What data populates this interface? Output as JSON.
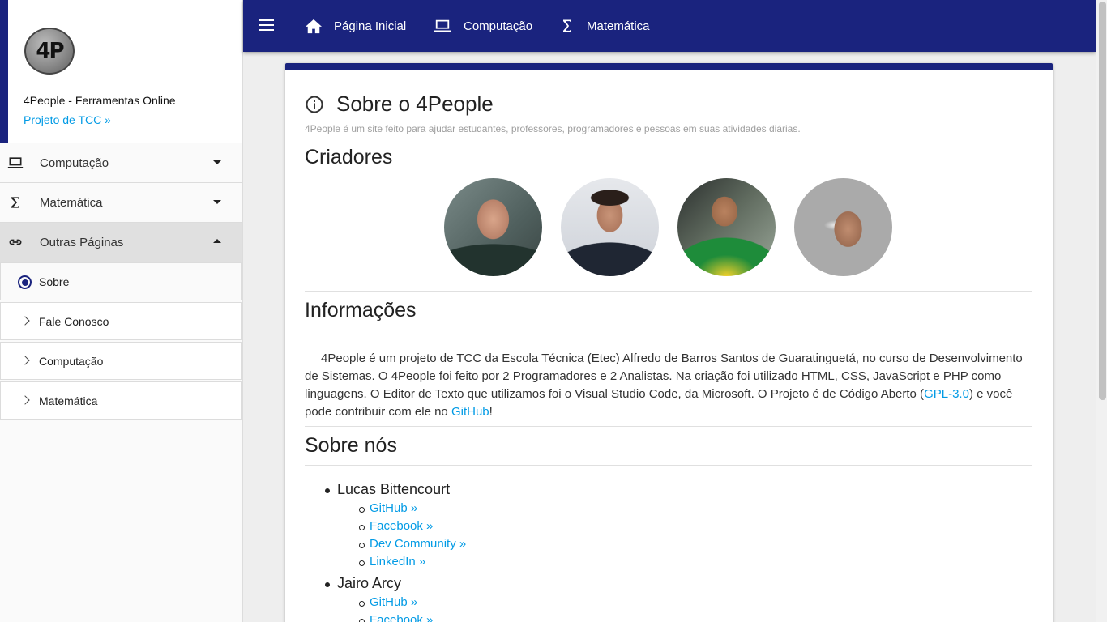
{
  "sidebar": {
    "logo_text": "4P",
    "site_name": "4People - Ferramentas Online",
    "tcc_link": "Projeto de TCC »",
    "menu": [
      {
        "label": "Computação",
        "icon": "laptop-icon"
      },
      {
        "label": "Matemática",
        "icon": "sigma-icon"
      },
      {
        "label": "Outras Páginas",
        "icon": "link-icon"
      }
    ],
    "submenu": [
      {
        "label": "Sobre",
        "selected": true
      },
      {
        "label": "Fale Conosco"
      },
      {
        "label": "Computação"
      },
      {
        "label": "Matemática"
      }
    ]
  },
  "topnav": {
    "links": [
      {
        "label": "Página Inicial",
        "icon": "home-icon"
      },
      {
        "label": "Computação",
        "icon": "laptop-icon"
      },
      {
        "label": "Matemática",
        "icon": "sigma-icon"
      }
    ]
  },
  "colors": {
    "primary": "#1a237e",
    "link": "#039be5"
  },
  "main": {
    "title": "Sobre o 4People",
    "subtitle": "4People é um site feito para ajudar estudantes, professores, programadores e pessoas em suas atividades diárias.",
    "creators_heading": "Criadores",
    "info_heading": "Informações",
    "info_text_1": "4People é um projeto de TCC da Escola Técnica (Etec) Alfredo de Barros Santos de Guaratinguetá, no curso de Desenvolvimento de Sistemas. O 4People foi feito por 2 Programadores e 2 Analistas. Na criação foi utilizado HTML, CSS, JavaScript e PHP como linguagens. O Editor de Texto que utilizamos foi o Visual Studio Code, da Microsoft. O Projeto é de Código Aberto (",
    "info_link_license": "GPL-3.0",
    "info_text_2": ") e você pode contribuir com ele no ",
    "info_link_github": "GitHub",
    "info_text_3": "!",
    "about_heading": "Sobre nós",
    "people": [
      {
        "name": "Lucas Bittencourt",
        "links": [
          "GitHub »",
          "Facebook »",
          "Dev Community »",
          "LinkedIn »"
        ]
      },
      {
        "name": "Jairo Arcy",
        "links": [
          "GitHub »",
          "Facebook »"
        ]
      }
    ]
  }
}
